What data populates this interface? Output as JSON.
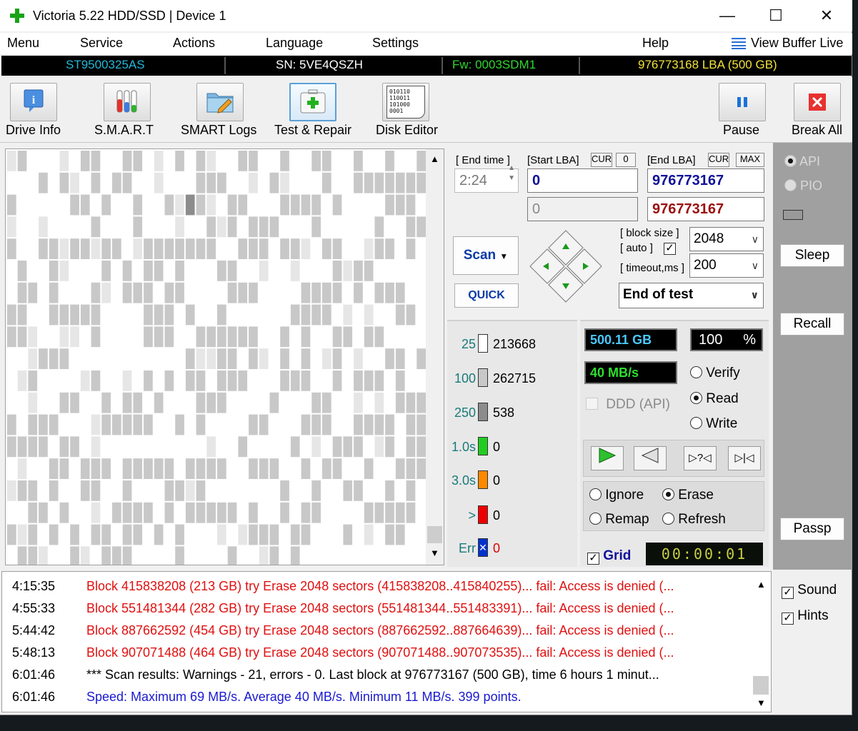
{
  "window": {
    "title": "Victoria 5.22 HDD/SSD | Device 1",
    "minimize": "—",
    "maximize": "☐",
    "close": "✕"
  },
  "menu": {
    "items": [
      "Menu",
      "Service",
      "Actions",
      "Language",
      "Settings",
      "Help"
    ],
    "view_buffer": "View Buffer Live"
  },
  "drive": {
    "model": "ST9500325AS",
    "serial": "SN: 5VE4QSZH",
    "firmware": "Fw: 0003SDM1",
    "capacity": "976773168 LBA (500 GB)"
  },
  "toolbar": {
    "drive_info": "Drive Info",
    "smart": "S.M.A.R.T",
    "smart_logs": "SMART Logs",
    "test_repair": "Test & Repair",
    "disk_editor": "Disk Editor",
    "disk_editor_glyph": "010110\n110011\n101000\n0001",
    "pause": "Pause",
    "break_all": "Break All"
  },
  "scan_params": {
    "end_time_label": "[ End time ]",
    "end_time_value": "2:24",
    "start_lba_label": "[Start LBA]",
    "cur_label": "CUR",
    "zero_label": "0",
    "end_lba_label": "[End LBA]",
    "max_label": "MAX",
    "start_lba": "0",
    "end_lba": "976773167",
    "start_lba_current": "0",
    "end_lba_current": "976773167",
    "block_size_label": "[ block size ]",
    "auto_label": "[ auto ]",
    "auto_checked": true,
    "block_size": "2048",
    "timeout_label": "[ timeout,ms ]",
    "timeout": "200",
    "scan_button": "Scan",
    "quick_button": "QUICK",
    "end_of_test": "End of test"
  },
  "legend": [
    {
      "label": "25",
      "value": "213668",
      "color": "#ffffff",
      "label_color": "#1a7a7a",
      "value_color": "#000000"
    },
    {
      "label": "100",
      "value": "262715",
      "color": "#c8c8c8",
      "label_color": "#1a7a7a",
      "value_color": "#000000"
    },
    {
      "label": "250",
      "value": "538",
      "color": "#8c8c8c",
      "label_color": "#1a7a7a",
      "value_color": "#000000"
    },
    {
      "label": "1.0s",
      "value": "0",
      "color": "#22cc22",
      "label_color": "#1a7a7a",
      "value_color": "#000000"
    },
    {
      "label": "3.0s",
      "value": "0",
      "color": "#ff8800",
      "label_color": "#1a7a7a",
      "value_color": "#000000"
    },
    {
      "label": ">",
      "value": "0",
      "color": "#ee0000",
      "label_color": "#1a7a7a",
      "value_color": "#000000"
    },
    {
      "label": "Err",
      "value": "0",
      "color": "#0033cc",
      "label_color": "#1a7a7a",
      "value_color": "#dd0000"
    }
  ],
  "stats": {
    "position": "500.11 GB",
    "percent": "100",
    "percent_sign": "%",
    "speed": "40 MB/s",
    "ddd_api": "DDD (API)",
    "timer": "00:00:01"
  },
  "mode": {
    "verify": "Verify",
    "read": "Read",
    "write": "Write",
    "selected": "read"
  },
  "repair": {
    "ignore": "Ignore",
    "erase": "Erase",
    "remap": "Remap",
    "refresh": "Refresh",
    "selected": "erase"
  },
  "grid_label": "Grid",
  "side": {
    "api": "API",
    "pio": "PIO",
    "sleep": "Sleep",
    "recall": "Recall",
    "passp": "Passp",
    "sound": "Sound",
    "hints": "Hints"
  },
  "log": [
    {
      "time": "4:15:35",
      "text": "Block 415838208 (213 GB) try Erase 2048 sectors (415838208..415840255)... fail: Access is denied (...",
      "color": "#e01010"
    },
    {
      "time": "4:55:33",
      "text": "Block 551481344 (282 GB) try Erase 2048 sectors (551481344..551483391)... fail: Access is denied (...",
      "color": "#e01010"
    },
    {
      "time": "5:44:42",
      "text": "Block 887662592 (454 GB) try Erase 2048 sectors (887662592..887664639)... fail: Access is denied (...",
      "color": "#e01010"
    },
    {
      "time": "5:48:13",
      "text": "Block 907071488 (464 GB) try Erase 2048 sectors (907071488..907073535)... fail: Access is denied (...",
      "color": "#e01010"
    },
    {
      "time": "6:01:46",
      "text": "*** Scan results: Warnings - 21, errors - 0. Last block at 976773167 (500 GB), time 6 hours 1 minut...",
      "color": "#000000"
    },
    {
      "time": "6:01:46",
      "text": "Speed: Maximum 69 MB/s. Average 40 MB/s. Minimum 11 MB/s. 399 points.",
      "color": "#1a1ad0"
    }
  ],
  "colors": {
    "model": "#24b8d8",
    "serial": "#ffffff",
    "firmware": "#2fd82f",
    "capacity": "#f2e23a",
    "lba_blue": "#10109a",
    "lba_red": "#9a1010",
    "led_text": "#4bc8ff",
    "led_green": "#2ee02e",
    "timer_text": "#c8d040"
  }
}
